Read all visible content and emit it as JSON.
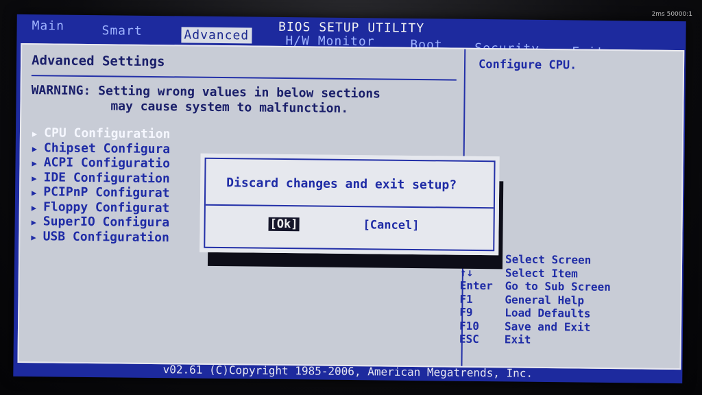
{
  "monitor": {
    "brand_text": "2ms  50000:1"
  },
  "header": {
    "title": "BIOS SETUP UTILITY",
    "tabs": [
      {
        "label": "Main"
      },
      {
        "label": "Smart"
      },
      {
        "label": "Advanced"
      },
      {
        "label": "H/W Monitor"
      },
      {
        "label": "Boot"
      },
      {
        "label": "Security"
      },
      {
        "label": "Exit"
      }
    ]
  },
  "main": {
    "section_title": "Advanced Settings",
    "warning_line1": "WARNING: Setting wrong values in below sections",
    "warning_line2": "may cause system to malfunction.",
    "menu_items": [
      {
        "label": "CPU Configuration"
      },
      {
        "label": "Chipset Configura"
      },
      {
        "label": "ACPI Configuratio"
      },
      {
        "label": "IDE Configuration"
      },
      {
        "label": "PCIPnP Configurat"
      },
      {
        "label": "Floppy Configurat"
      },
      {
        "label": "SuperIO Configura"
      },
      {
        "label": "USB Configuration"
      }
    ]
  },
  "help": {
    "description": "Configure CPU.",
    "keys": [
      {
        "key": "",
        "action": "Select Screen"
      },
      {
        "key": "↑↓",
        "action": "Select Item"
      },
      {
        "key": "Enter",
        "action": "Go to Sub Screen"
      },
      {
        "key": "F1",
        "action": "General Help"
      },
      {
        "key": "F9",
        "action": "Load Defaults"
      },
      {
        "key": "F10",
        "action": "Save and Exit"
      },
      {
        "key": "ESC",
        "action": "Exit"
      }
    ]
  },
  "dialog": {
    "message": "Discard changes and exit setup?",
    "ok_label": "[Ok]",
    "cancel_label": "[Cancel]"
  },
  "footer": {
    "copyright": "v02.61 (C)Copyright 1985-2006, American Megatrends, Inc."
  },
  "colors": {
    "bios_blue": "#1d2a9e",
    "panel_gray": "#c8ccd6",
    "text_blue": "#1f2ca6",
    "selected_text": "#f5f7ff"
  }
}
